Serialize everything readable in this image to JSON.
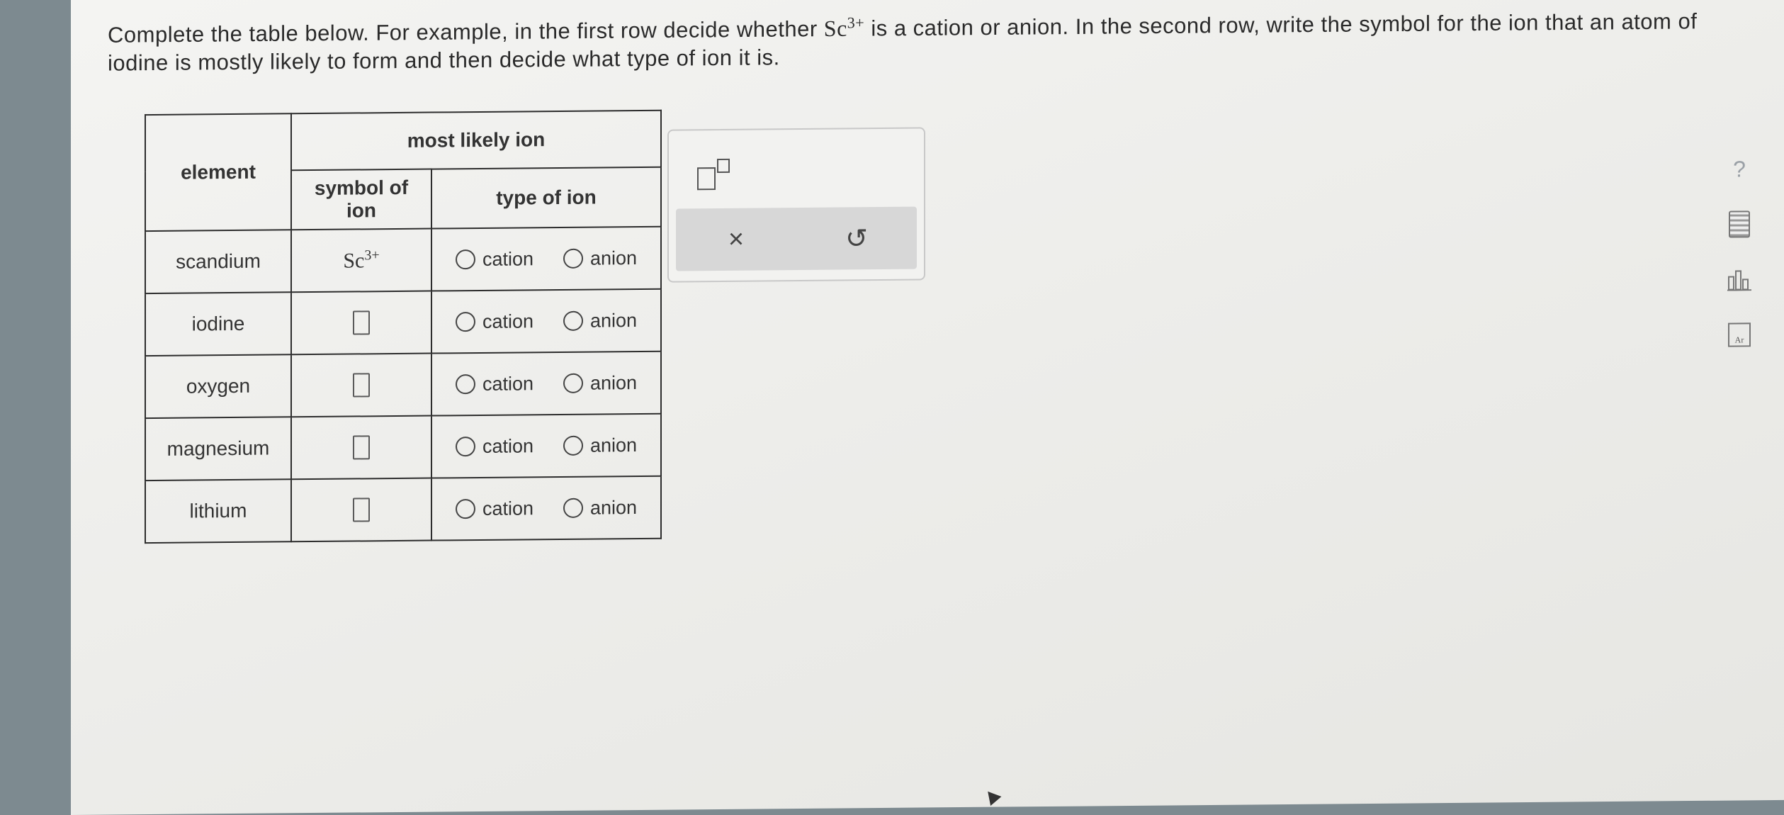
{
  "instructions": {
    "part1": "Complete the table below. For example, in the first row decide whether ",
    "symbol": "Sc",
    "charge": "3+",
    "part2": " is a cation or anion. In the second row, write the symbol for the ion that an atom of iodine is mostly likely to form and then decide what type of ion it is."
  },
  "table": {
    "header_element": "element",
    "header_most_likely": "most likely ion",
    "header_symbol_l1": "symbol of",
    "header_symbol_l2": "ion",
    "header_type": "type of ion",
    "option_cation": "cation",
    "option_anion": "anion",
    "rows": [
      {
        "element": "scandium",
        "symbol": "Sc",
        "charge": "3+"
      },
      {
        "element": "iodine",
        "symbol": "",
        "charge": ""
      },
      {
        "element": "oxygen",
        "symbol": "",
        "charge": ""
      },
      {
        "element": "magnesium",
        "symbol": "",
        "charge": ""
      },
      {
        "element": "lithium",
        "symbol": "",
        "charge": ""
      }
    ]
  },
  "tool_panel": {
    "superscript_icon": "superscript-template-icon",
    "clear_label": "×",
    "undo_label": "↺"
  },
  "side_tools": {
    "help_label": "?",
    "calculator_icon": "calculator-icon",
    "chart_icon": "bar-chart-icon",
    "periodic_label": "Ar"
  }
}
